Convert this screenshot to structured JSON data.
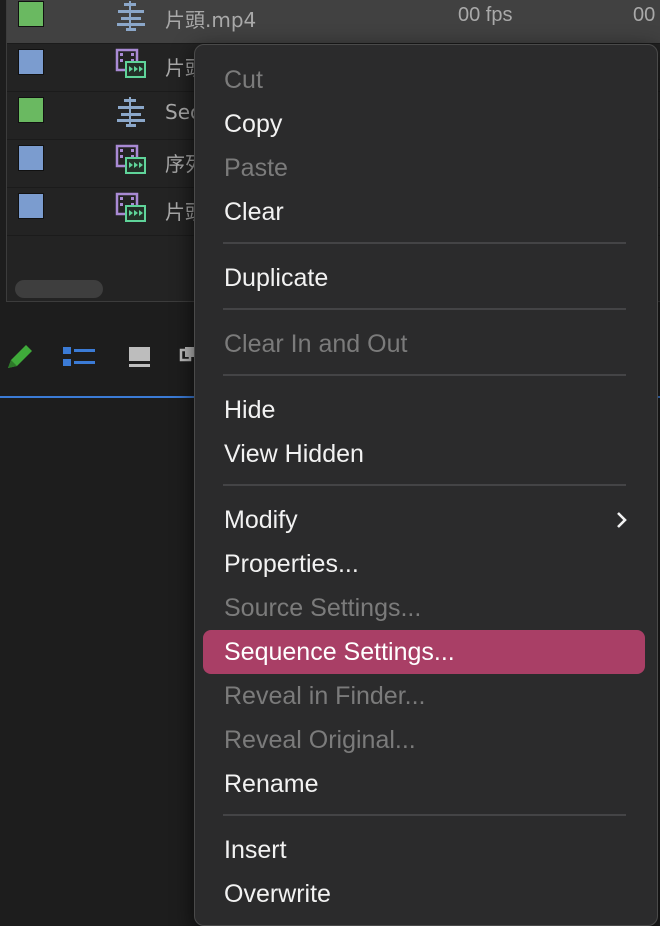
{
  "project_rows": [
    {
      "name": "片頭.mp4",
      "fps": "00 fps",
      "extra": "00",
      "swatch": "#6ab961",
      "icon": "audio-clip-icon",
      "selected": true
    },
    {
      "name": "片頭",
      "fps": "",
      "extra": "",
      "swatch": "#7b9ccf",
      "icon": "sequence-icon",
      "selected": false
    },
    {
      "name": "Sec",
      "fps": "",
      "extra": "",
      "swatch": "#6ab961",
      "icon": "audio-clip-icon",
      "selected": false
    },
    {
      "name": "序列",
      "fps": "",
      "extra": "",
      "swatch": "#7b9ccf",
      "icon": "sequence-icon",
      "selected": false
    },
    {
      "name": "片頭",
      "fps": "",
      "extra": "",
      "swatch": "#7b9ccf",
      "icon": "sequence-icon",
      "selected": false
    }
  ],
  "toolbar": {
    "icons": [
      "pencil-icon",
      "list-view-icon",
      "icon-view-icon",
      "freeform-view-icon"
    ]
  },
  "context_menu": {
    "items": [
      {
        "label": "Cut",
        "disabled": true
      },
      {
        "label": "Copy",
        "disabled": false
      },
      {
        "label": "Paste",
        "disabled": true
      },
      {
        "label": "Clear",
        "disabled": false
      },
      {
        "label": "Duplicate",
        "disabled": false
      },
      {
        "label": "Clear In and Out",
        "disabled": true
      },
      {
        "label": "Hide",
        "disabled": false
      },
      {
        "label": "View Hidden",
        "disabled": false
      },
      {
        "label": "Modify",
        "disabled": false,
        "submenu": true
      },
      {
        "label": "Properties...",
        "disabled": false
      },
      {
        "label": "Source Settings...",
        "disabled": true
      },
      {
        "label": "Sequence Settings...",
        "disabled": false,
        "highlighted": true
      },
      {
        "label": "Reveal in Finder...",
        "disabled": true
      },
      {
        "label": "Reveal Original...",
        "disabled": true
      },
      {
        "label": "Rename",
        "disabled": false
      },
      {
        "label": "Insert",
        "disabled": false
      },
      {
        "label": "Overwrite",
        "disabled": false
      }
    ]
  },
  "colors": {
    "highlight": "#a93f66",
    "accent_line": "#3b7bd6",
    "menu_bg": "#2b2b2c"
  }
}
